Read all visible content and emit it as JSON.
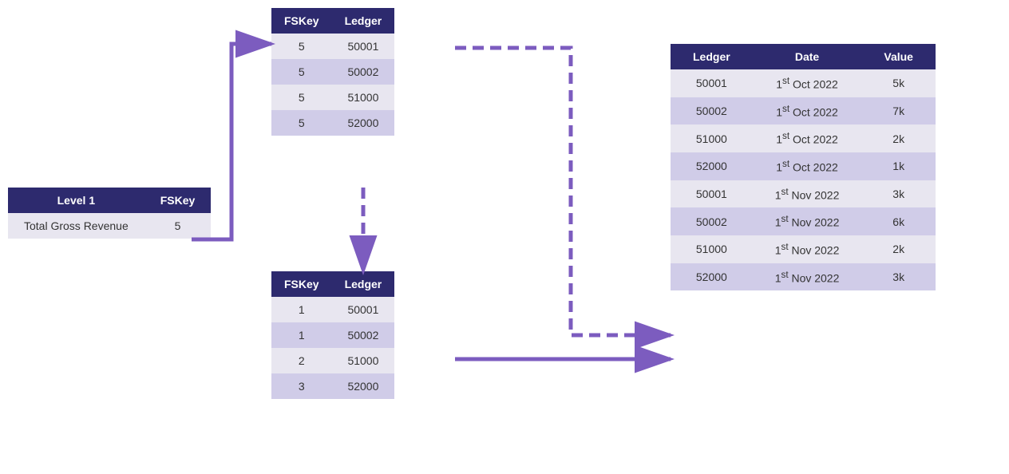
{
  "leftTable": {
    "headers": [
      "Level 1",
      "FSKey"
    ],
    "rows": [
      {
        "level1": "Total Gross Revenue",
        "fskey": "5"
      }
    ]
  },
  "topMidTable": {
    "headers": [
      "FSKey",
      "Ledger"
    ],
    "rows": [
      {
        "fskey": "5",
        "ledger": "50001"
      },
      {
        "fskey": "5",
        "ledger": "50002"
      },
      {
        "fskey": "5",
        "ledger": "51000"
      },
      {
        "fskey": "5",
        "ledger": "52000"
      }
    ]
  },
  "botMidTable": {
    "headers": [
      "FSKey",
      "Ledger"
    ],
    "rows": [
      {
        "fskey": "1",
        "ledger": "50001"
      },
      {
        "fskey": "1",
        "ledger": "50002"
      },
      {
        "fskey": "2",
        "ledger": "51000"
      },
      {
        "fskey": "3",
        "ledger": "52000"
      }
    ]
  },
  "rightTable": {
    "headers": [
      "Ledger",
      "Date",
      "Value"
    ],
    "rows": [
      {
        "ledger": "50001",
        "date": "1st Oct 2022",
        "value": "5k"
      },
      {
        "ledger": "50002",
        "date": "1st Oct 2022",
        "value": "7k"
      },
      {
        "ledger": "51000",
        "date": "1st Oct 2022",
        "value": "2k"
      },
      {
        "ledger": "52000",
        "date": "1st Oct 2022",
        "value": "1k"
      },
      {
        "ledger": "50001",
        "date": "1st Nov 2022",
        "value": "3k"
      },
      {
        "ledger": "50002",
        "date": "1st Nov 2022",
        "value": "6k"
      },
      {
        "ledger": "51000",
        "date": "1st Nov 2022",
        "value": "2k"
      },
      {
        "ledger": "52000",
        "date": "1st Nov 2022",
        "value": "3k"
      }
    ]
  },
  "arrowColor": "#7c5cbf"
}
